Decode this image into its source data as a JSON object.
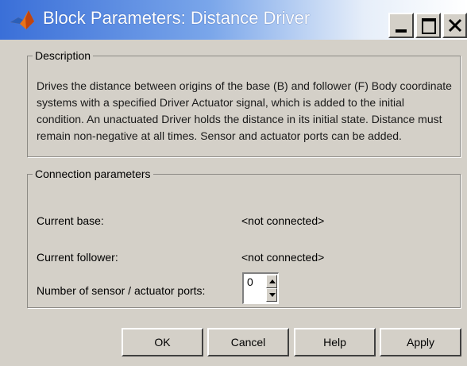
{
  "window": {
    "title": "Block Parameters: Distance Driver",
    "icon": "matlab-membrane-icon",
    "controls": [
      "minimize-icon",
      "maximize-icon",
      "close-icon"
    ]
  },
  "description": {
    "legend": "Description",
    "text": "Drives the distance between origins of the base (B) and follower (F) Body coordinate systems with a specified Driver Actuator signal, which is added to the initial condition. An unactuated Driver holds the distance in its initial state. Distance must remain non-negative at all times. Sensor and actuator ports can be added."
  },
  "connection": {
    "legend": "Connection parameters",
    "base_label": "Current base:",
    "base_value": "<not connected>",
    "follower_label": "Current follower:",
    "follower_value": "<not connected>",
    "ports_label": "Number of sensor / actuator ports:",
    "ports_value": "0"
  },
  "buttons": {
    "ok": "OK",
    "cancel": "Cancel",
    "help": "Help",
    "apply": "Apply"
  },
  "colors": {
    "title_gradient_start": "#3a6fd8",
    "title_gradient_end": "#ffffff",
    "dialog_face": "#d4d0c8",
    "icon_orange": "#e8731a"
  }
}
